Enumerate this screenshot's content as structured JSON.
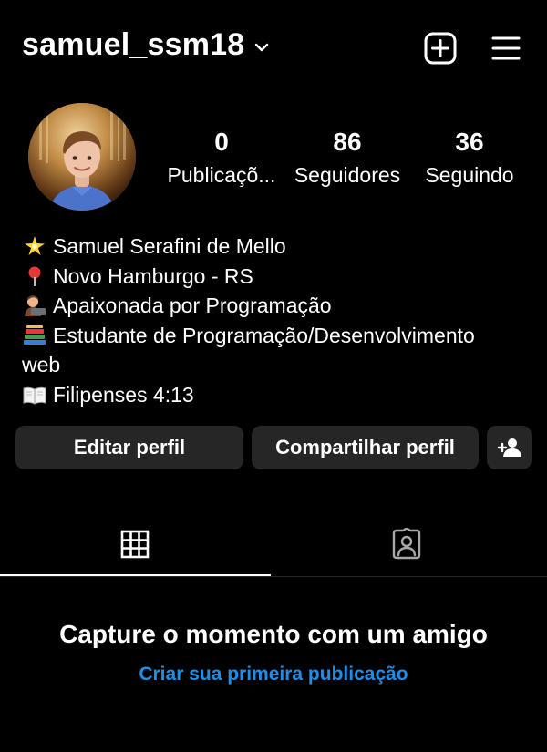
{
  "header": {
    "username": "samuel_ssm18",
    "icons": [
      "chevron-down-icon",
      "new-post-icon",
      "menu-icon"
    ]
  },
  "profile": {
    "avatar_icon": "profile-photo",
    "stats": {
      "posts": {
        "value": "0",
        "label": "Publicaçõ..."
      },
      "followers": {
        "value": "86",
        "label": "Seguidores"
      },
      "following": {
        "value": "36",
        "label": "Seguindo"
      }
    }
  },
  "bio": {
    "lines": [
      {
        "emoji": "sparkle-star",
        "text": "Samuel Serafini de Mello"
      },
      {
        "emoji": "map-pin",
        "text": "Novo Hamburgo -  RS"
      },
      {
        "emoji": "person-laptop",
        "text": "Apaixonada por Programação"
      },
      {
        "emoji": "books",
        "text": "Estudante de Programação/Desenvolvimento"
      },
      {
        "emoji": "",
        "text": "web"
      },
      {
        "emoji": "open-book",
        "text": "Filipenses 4:13"
      }
    ]
  },
  "actions": {
    "edit_label": "Editar perfil",
    "share_label": "Compartilhar perfil",
    "add_person_icon": "add-person-icon"
  },
  "tabs": {
    "active": "grid",
    "items": [
      {
        "name": "grid",
        "icon": "grid-icon"
      },
      {
        "name": "tagged",
        "icon": "tagged-icon"
      }
    ]
  },
  "empty_state": {
    "title": "Capture o momento com um amigo",
    "link": "Criar sua primeira publicação"
  },
  "colors": {
    "background": "#000000",
    "button_bg": "#262626",
    "link": "#1d8fe9"
  }
}
